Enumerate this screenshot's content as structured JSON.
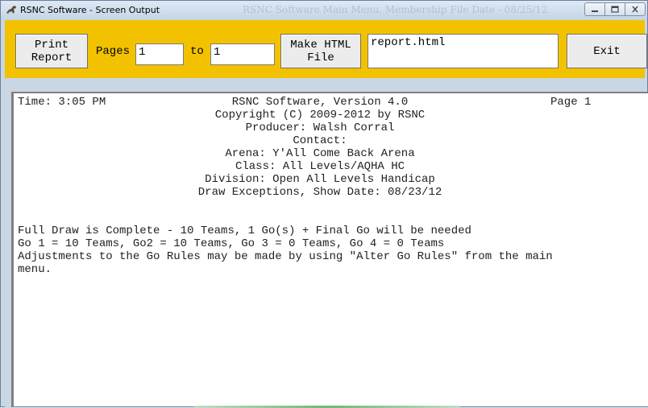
{
  "window": {
    "title": "RSNC Software - Screen Output",
    "background_title": "RSNC Software Main Menu, Membership File Date - 08/25/12",
    "controls": [
      "minimize",
      "maximize",
      "close"
    ]
  },
  "toolbar": {
    "print_label": "Print\nReport",
    "pages_label": "Pages",
    "pages_from": "1",
    "to_label": "to",
    "pages_to": "1",
    "html_label": "Make HTML\nFile",
    "html_filename": "report.html",
    "exit_label": "Exit",
    "accent_color": "#f2c200"
  },
  "report": {
    "time": "Time: 3:05 PM",
    "page": "Page 1",
    "header_lines": [
      "RSNC Software, Version 4.0",
      "Copyright (C) 2009-2012 by RSNC",
      "Producer: Walsh Corral",
      "Contact:",
      "Arena: Y'All Come Back Arena",
      "Class: All Levels/AQHA HC",
      "Division: Open All Levels Handicap",
      "Draw Exceptions, Show Date: 08/23/12"
    ],
    "body_lines": [
      "Full Draw is Complete - 10 Teams, 1 Go(s) + Final Go will be needed",
      "Go 1 = 10 Teams, Go2 = 10 Teams, Go 3 = 0 Teams, Go 4 = 0 Teams",
      "Adjustments to the Go Rules may be made by using \"Alter Go Rules\" from the main",
      "menu."
    ]
  }
}
